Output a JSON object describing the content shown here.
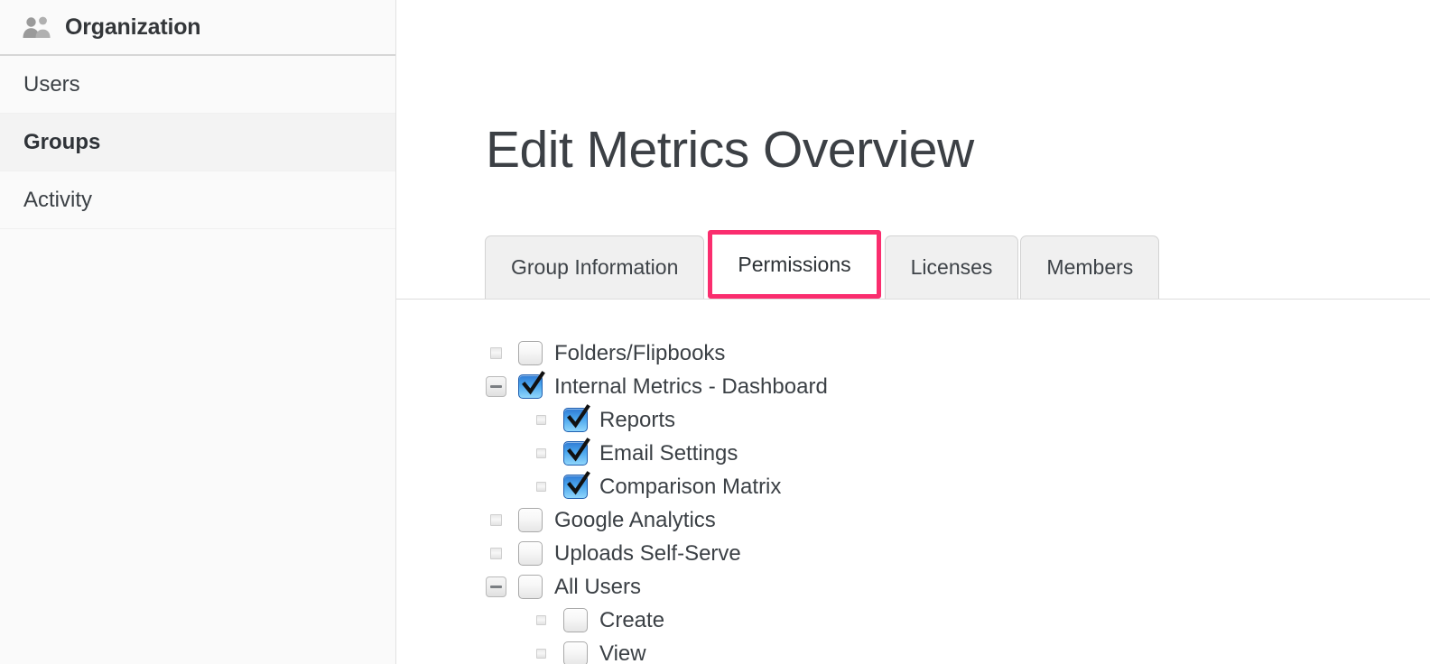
{
  "sidebar": {
    "header": {
      "icon": "users-group-icon",
      "title": "Organization"
    },
    "items": [
      {
        "label": "Users",
        "active": false
      },
      {
        "label": "Groups",
        "active": true
      },
      {
        "label": "Activity",
        "active": false
      }
    ]
  },
  "main": {
    "page_title": "Edit Metrics Overview",
    "tabs": [
      {
        "label": "Group Information",
        "active": false
      },
      {
        "label": "Permissions",
        "active": true
      },
      {
        "label": "Licenses",
        "active": false
      },
      {
        "label": "Members",
        "active": false
      }
    ],
    "active_tab_highlight_color": "#fa2d6e",
    "tree": [
      {
        "label": "Folders/Flipbooks",
        "checked": false,
        "depth": 0,
        "toggle": "leaf"
      },
      {
        "label": "Internal Metrics - Dashboard",
        "checked": true,
        "depth": 0,
        "toggle": "minus"
      },
      {
        "label": "Reports",
        "checked": true,
        "depth": 1,
        "toggle": "leaf"
      },
      {
        "label": "Email Settings",
        "checked": true,
        "depth": 1,
        "toggle": "leaf"
      },
      {
        "label": "Comparison Matrix",
        "checked": true,
        "depth": 1,
        "toggle": "leaf"
      },
      {
        "label": "Google Analytics",
        "checked": false,
        "depth": 0,
        "toggle": "leaf"
      },
      {
        "label": "Uploads Self-Serve",
        "checked": false,
        "depth": 0,
        "toggle": "leaf"
      },
      {
        "label": "All Users",
        "checked": false,
        "depth": 0,
        "toggle": "minus"
      },
      {
        "label": "Create",
        "checked": false,
        "depth": 1,
        "toggle": "leaf"
      },
      {
        "label": "View",
        "checked": false,
        "depth": 1,
        "toggle": "leaf"
      }
    ]
  }
}
